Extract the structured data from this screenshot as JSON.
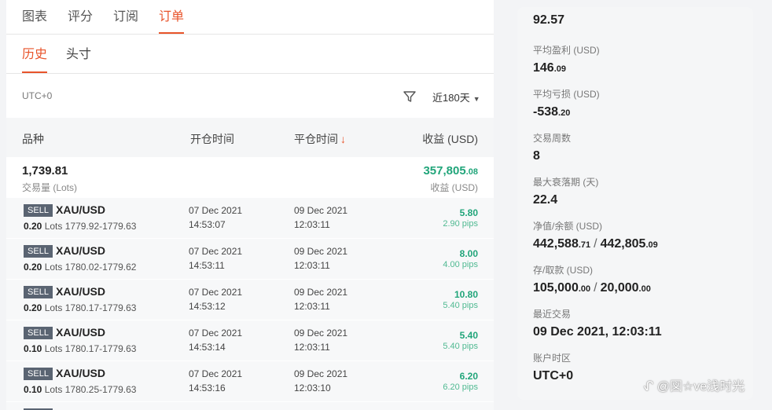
{
  "top_tabs": [
    "图表",
    "评分",
    "订阅",
    "订单"
  ],
  "sub_tabs": [
    "历史",
    "头寸"
  ],
  "filter": {
    "timezone": "UTC+0",
    "range": "近180天"
  },
  "columns": {
    "symbol": "品种",
    "open_time": "开仓时间",
    "close_time": "平仓时间",
    "profit": "收益 (USD)"
  },
  "summary": {
    "lots": "1,739.81",
    "lots_label": "交易量 (Lots)",
    "profit_main": "357,805",
    "profit_dec": ".08",
    "profit_label": "收益 (USD)"
  },
  "orders": [
    {
      "side": "SELL",
      "symbol": "XAU/USD",
      "lots": "0.20",
      "lots_unit": "Lots",
      "prices": "1779.92-1779.63",
      "open_date": "07 Dec 2021",
      "open_time": "14:53:07",
      "close_date": "09 Dec 2021",
      "close_time": "12:03:11",
      "pnl": "5.80",
      "pips": "2.90 pips"
    },
    {
      "side": "SELL",
      "symbol": "XAU/USD",
      "lots": "0.20",
      "lots_unit": "Lots",
      "prices": "1780.02-1779.62",
      "open_date": "07 Dec 2021",
      "open_time": "14:53:11",
      "close_date": "09 Dec 2021",
      "close_time": "12:03:11",
      "pnl": "8.00",
      "pips": "4.00 pips"
    },
    {
      "side": "SELL",
      "symbol": "XAU/USD",
      "lots": "0.20",
      "lots_unit": "Lots",
      "prices": "1780.17-1779.63",
      "open_date": "07 Dec 2021",
      "open_time": "14:53:12",
      "close_date": "09 Dec 2021",
      "close_time": "12:03:11",
      "pnl": "10.80",
      "pips": "5.40 pips"
    },
    {
      "side": "SELL",
      "symbol": "XAU/USD",
      "lots": "0.10",
      "lots_unit": "Lots",
      "prices": "1780.17-1779.63",
      "open_date": "07 Dec 2021",
      "open_time": "14:53:14",
      "close_date": "09 Dec 2021",
      "close_time": "12:03:11",
      "pnl": "5.40",
      "pips": "5.40 pips"
    },
    {
      "side": "SELL",
      "symbol": "XAU/USD",
      "lots": "0.10",
      "lots_unit": "Lots",
      "prices": "1780.25-1779.63",
      "open_date": "07 Dec 2021",
      "open_time": "14:53:16",
      "close_date": "09 Dec 2021",
      "close_time": "12:03:10",
      "pnl": "6.20",
      "pips": "6.20 pips"
    }
  ],
  "stats": {
    "win_rate": {
      "value": "92.57"
    },
    "avg_profit": {
      "label": "平均盈利 (USD)",
      "main": "146",
      "dec": ".09"
    },
    "avg_loss": {
      "label": "平均亏损 (USD)",
      "main": "-538",
      "dec": ".20"
    },
    "weeks": {
      "label": "交易周数",
      "value": "8"
    },
    "max_drawdown": {
      "label": "最大衰落期 (天)",
      "value": "22.4"
    },
    "equity_balance": {
      "label": "净值/余额 (USD)",
      "a_main": "442,588",
      "a_dec": ".71",
      "sep": "/",
      "b_main": "442,805",
      "b_dec": ".09"
    },
    "deposit_withdraw": {
      "label": "存/取款 (USD)",
      "a_main": "105,000",
      "a_dec": ".00",
      "sep": "/",
      "b_main": "20,000",
      "b_dec": ".00"
    },
    "last_trade": {
      "label": "最近交易",
      "value": "09 Dec 2021, 12:03:11"
    },
    "account_tz": {
      "label": "账户时区",
      "value": "UTC+0"
    }
  },
  "watermark": "ᖋ @図☆ve浅时光",
  "colors": {
    "accent": "#e8542b",
    "profit_green": "#21a57a",
    "sell_badge": "#5a6472"
  }
}
